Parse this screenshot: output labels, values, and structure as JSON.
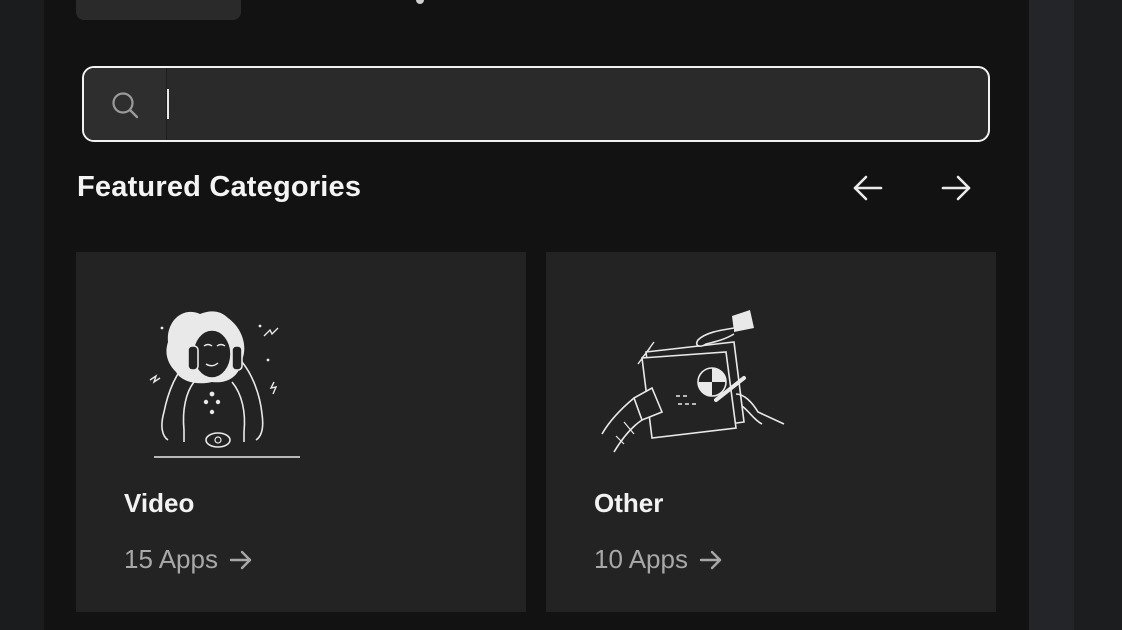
{
  "search": {
    "value": "",
    "placeholder": ""
  },
  "section": {
    "title": "Featured Categories"
  },
  "categories": [
    {
      "title": "Video",
      "count": "15 Apps",
      "icon": "woman-on-phone-illustration"
    },
    {
      "title": "Other",
      "count": "10 Apps",
      "icon": "hands-with-documents-illustration"
    }
  ],
  "colors": {
    "panel": "#121212",
    "card": "#232323",
    "search_bg": "#2a2a2a",
    "text": "#f2f2f2",
    "muted": "#a8a8a8"
  }
}
